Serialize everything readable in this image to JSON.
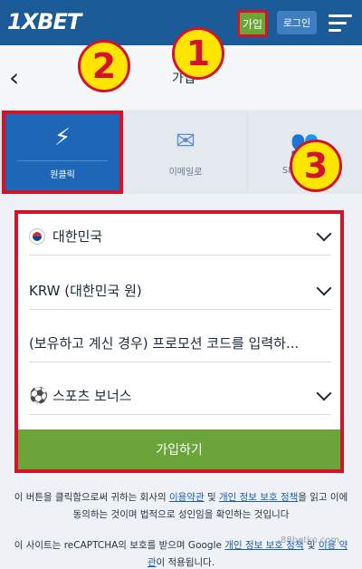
{
  "header": {
    "logo_text": "1XBET",
    "join_label": "가입",
    "login_label": "로그인"
  },
  "nav": {
    "back_glyph": "‹",
    "title": "가입"
  },
  "tabs": [
    {
      "label": "원클릭",
      "icon": "lightning-icon",
      "glyph": "⚡",
      "active": true
    },
    {
      "label": "이메일로",
      "icon": "envelope-icon",
      "glyph": "✉",
      "active": false
    },
    {
      "label": "SNS",
      "icon": "people-icon",
      "glyph": "👥",
      "active": false
    }
  ],
  "form": {
    "country_value": "대한민국",
    "currency_value": "KRW (대한민국 원)",
    "promo_placeholder": "(보유하고 계신 경우) 프로모션 코드를 입력하...",
    "bonus_value": "스포츠 보너스",
    "submit_label": "가입하기"
  },
  "legal": {
    "line1_a": "이 버튼을 클릭함으로써 귀하는 회사의 ",
    "terms_link": "이용약관",
    "line1_b": " 및 ",
    "privacy_link": "개인 정보 보호 정책",
    "line1_c": "을 읽고 이에 동의하는 것이며 법적으로 성인임을 확인하는 것입니다",
    "line2_a": "이 사이트는 reCAPTCHA의 보호를 받으며 Google ",
    "google_privacy_link": "개인 정보 보호 정책",
    "line2_b": " 및 ",
    "google_terms_link": "이용 약관",
    "line2_c": "이 적용됩니다."
  },
  "badges": [
    "1",
    "2",
    "3"
  ],
  "watermark": "88betko.com",
  "colors": {
    "header_blue": "#1a5b98",
    "active_tab_blue": "#1d67b6",
    "green": "#6ba539",
    "highlight_red": "#d3132a",
    "badge_yellow": "#ffe500"
  }
}
